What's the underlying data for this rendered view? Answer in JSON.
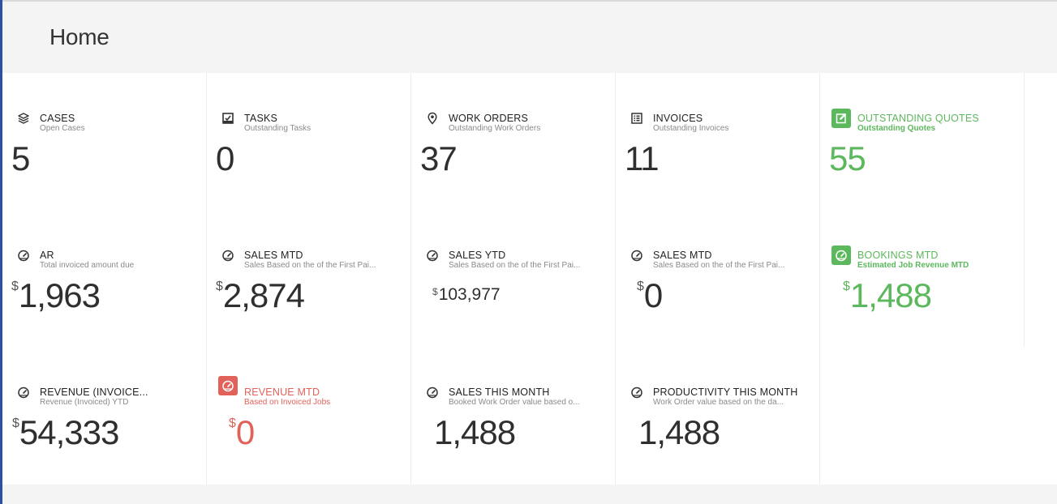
{
  "header": {
    "title": "Home"
  },
  "colors": {
    "accent_green": "#5cb85c",
    "accent_red": "#e0625a",
    "sidebar_accent": "#2d50a6"
  },
  "tiles": [
    {
      "title": "CASES",
      "subtitle": "Open Cases",
      "currency": "",
      "value": "5",
      "icon": "layers-icon"
    },
    {
      "title": "TASKS",
      "subtitle": "Outstanding Tasks",
      "currency": "",
      "value": "0",
      "icon": "checkbox-icon"
    },
    {
      "title": "WORK ORDERS",
      "subtitle": "Outstanding Work Orders",
      "currency": "",
      "value": "37",
      "icon": "location-pin-icon"
    },
    {
      "title": "INVOICES",
      "subtitle": "Outstanding Invoices",
      "currency": "",
      "value": "11",
      "icon": "list-icon"
    },
    {
      "title": "OUTSTANDING QUOTES",
      "subtitle": "Outstanding Quotes",
      "currency": "",
      "value": "55",
      "icon": "edit-icon",
      "color": "green"
    },
    {
      "title": "AR",
      "subtitle": "Total invoiced amount due",
      "currency": "$",
      "value": "1,963",
      "icon": "gauge-icon"
    },
    {
      "title": "SALES MTD",
      "subtitle": "Sales Based on the of the First Pai...",
      "currency": "$",
      "value": "2,874",
      "icon": "gauge-icon"
    },
    {
      "title": "SALES YTD",
      "subtitle": "Sales Based on the of the First Pai...",
      "currency": "$",
      "value": "103,977",
      "icon": "gauge-icon",
      "small": true
    },
    {
      "title": "SALES MTD",
      "subtitle": "Sales Based on the of the First Pai...",
      "currency": "$",
      "value": "0",
      "icon": "gauge-icon"
    },
    {
      "title": "BOOKINGS MTD",
      "subtitle": "Estimated Job Revenue MTD",
      "currency": "$",
      "value": "1,488",
      "icon": "gauge-icon",
      "color": "green"
    },
    {
      "title": "REVENUE (INVOICE...",
      "subtitle": "Revenue (Invoiced) YTD",
      "currency": "$",
      "value": "54,333",
      "icon": "gauge-icon"
    },
    {
      "title": "REVENUE MTD",
      "subtitle": "Based on Invoiced Jobs",
      "currency": "$",
      "value": "0",
      "icon": "gauge-icon",
      "color": "red"
    },
    {
      "title": "SALES THIS MONTH",
      "subtitle": "Booked Work Order value based o...",
      "currency": "",
      "value": "1,488",
      "icon": "gauge-icon"
    },
    {
      "title": "PRODUCTIVITY THIS MONTH",
      "subtitle": "Work Order value based on the da...",
      "currency": "",
      "value": "1,488",
      "icon": "gauge-icon"
    }
  ]
}
